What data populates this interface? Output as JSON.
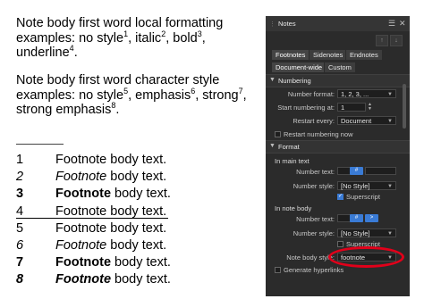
{
  "document": {
    "para1": {
      "a": "Note body first word local formatting",
      "b": "examples: no style",
      "s1": "1",
      "c": ", italic",
      "s2": "2",
      "d": ", bold",
      "s3": "3",
      "e": ",",
      "f": "underline",
      "s4": "4",
      "g": "."
    },
    "para2": {
      "a": "Note body first word character style",
      "b": "examples: no style",
      "s5": "5",
      "c": ", emphasis",
      "s6": "6",
      "d": ", strong",
      "s7": "7",
      "e": ",",
      "f": "strong emphasis",
      "s8": "8",
      "g": "."
    },
    "notes": [
      {
        "num": "1",
        "first": "Footnote",
        "rest": " body text."
      },
      {
        "num": "2",
        "first": "Footnote",
        "rest": " body text."
      },
      {
        "num": "3",
        "first": "Footnote",
        "rest": " body text."
      },
      {
        "num": "4",
        "first": "Footnote",
        "rest": " body text."
      },
      {
        "num": "5",
        "first": "Footnote",
        "rest": " body text."
      },
      {
        "num": "6",
        "first": "Footnote",
        "rest": " body text."
      },
      {
        "num": "7",
        "first": "Footnote",
        "rest": " body text."
      },
      {
        "num": "8",
        "first": "Footnote",
        "rest": " body text."
      }
    ]
  },
  "panel": {
    "title": "Notes",
    "icons": {
      "menu": "hamburger-menu-icon",
      "close": "close-icon",
      "up": "arrow-up-icon",
      "down": "arrow-down-icon",
      "grip": "drag-grip-icon"
    },
    "tabs": [
      "Footnotes",
      "Sidenotes",
      "Endnotes"
    ],
    "tabs2": [
      "Document-wide",
      "Custom"
    ],
    "numbering": {
      "section": "Numbering",
      "format_label": "Number format:",
      "format_value": "1, 2, 3, ...",
      "start_label": "Start numbering at:",
      "start_value": "1",
      "restart_label": "Restart every:",
      "restart_value": "Document",
      "restart_num_label": "Restart numbering now"
    },
    "format": {
      "section": "Format",
      "main_text": "In main text",
      "number_text_label": "Number text:",
      "number_text_value": "#",
      "number_style_label": "Number style:",
      "number_style_value": "[No Style]",
      "superscript": "Superscript",
      "note_body": "In note body",
      "nb_number_text_label": "Number text:",
      "nb_number_text_value": "#",
      "nb_number_text_extra": ">",
      "nb_number_style_label": "Number style:",
      "nb_number_style_value": "[No Style]",
      "nb_superscript": "Superscript",
      "note_body_style_label": "Note body style:",
      "note_body_style_value": "footnote",
      "hyperlinks": "Generate hyperlinks"
    },
    "colors": {
      "panel_bg": "#2b2b2b",
      "accent": "#3a7bd5",
      "highlight": "#e2001a"
    }
  }
}
